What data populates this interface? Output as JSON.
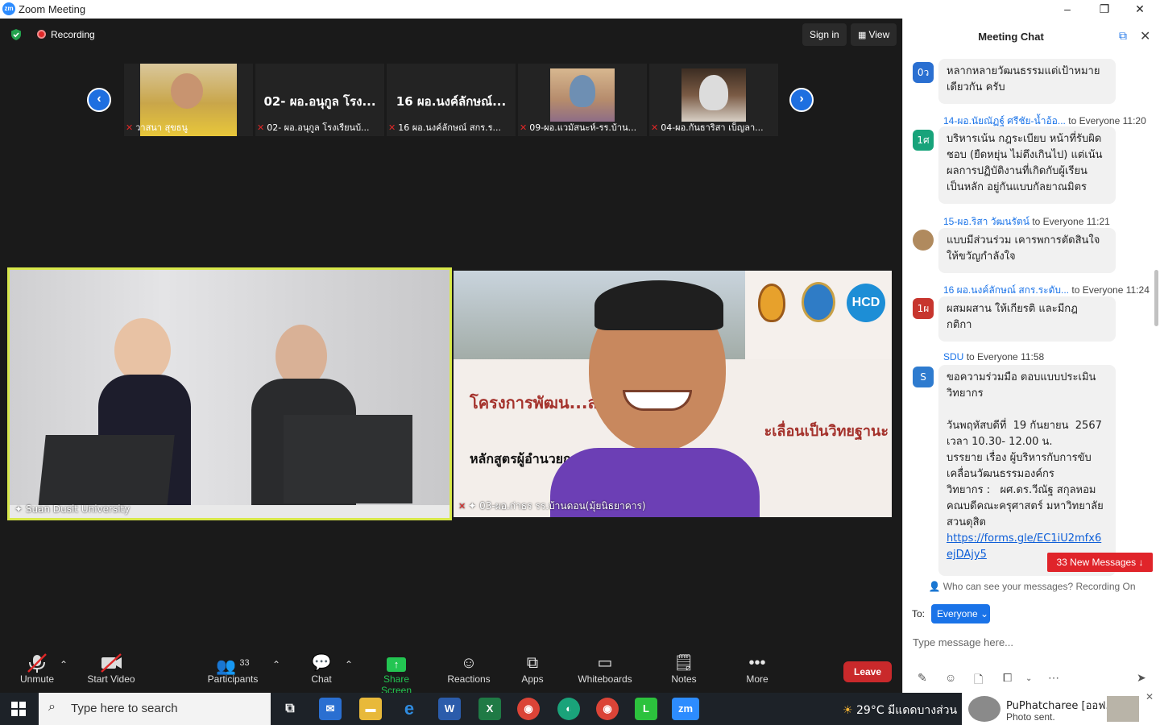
{
  "window": {
    "title": "Zoom Meeting",
    "minimize": "–",
    "restore": "❐",
    "close": "✕"
  },
  "topbar": {
    "recording": "Recording",
    "sign_in": "Sign in",
    "view": "View"
  },
  "thumbnails": [
    {
      "label": "วาสนา สุขธนู",
      "has_photo": true
    },
    {
      "display_name": "02- ผอ.อนุกูล โรง...",
      "label": "02- ผอ.อนุกูล โรงเรียนบ้..."
    },
    {
      "display_name": "16 ผอ.นงค์ลักษณ์...",
      "label": "16 ผอ.นงค์ลักษณ์ สกร.ร..."
    },
    {
      "label": "09-ผอ.แวมัสนะห์-รร.บ้าน...",
      "has_photo": true
    },
    {
      "label": "04-ผอ.กันธาริสา เบ็ญลา...",
      "has_photo": true
    }
  ],
  "videos": {
    "left_label": "Suan Dusit University",
    "right_label": "03-ผอ.ก่าธร รร.บ้านดอน(มุ้ยนิธยาคาร)",
    "banner_line1": "โครงการพัฒน...ลากรทางการศึกษา",
    "banner_line2": "ะเลื่อนเป็นวิทยฐานะ",
    "banner_line3": "หลักสูตรผู้อำนวยก...การเชี่ยวชาญ ระยะที่ 146",
    "logo_hcd": "HCD"
  },
  "toolbar": {
    "unmute": "Unmute",
    "start_video": "Start Video",
    "participants": "Participants",
    "participants_count": "33",
    "chat": "Chat",
    "share_screen": "Share Screen",
    "reactions": "Reactions",
    "apps": "Apps",
    "whiteboards": "Whiteboards",
    "notes": "Notes",
    "more": "More",
    "leave": "Leave"
  },
  "chat": {
    "title": "Meeting Chat",
    "messages": [
      {
        "avatar": "0ว",
        "avatar_color": "#2a6fd1",
        "sender": "",
        "to": "",
        "time": "",
        "text": "หลากหลายวัฒนธรรมแต่เป้าหมาย\nเดียวกัน ครับ"
      },
      {
        "avatar": "1ศ",
        "avatar_color": "#17a37a",
        "sender": "14-ผอ.นัยณัฏฐ์ ศรีชัย-น้ำอ้อ...",
        "to": "to Everyone",
        "time": "11:20",
        "text": "บริหารเน้น กฎระเบียบ หน้าที่รับผิด\nชอบ (ยืดหยุ่น ไม่ตึงเกินไป) แต่เน้น\nผลการปฏิบัติงานที่เกิดกับผู้เรียน\nเป็นหลัก อยู่กันแบบกัลยาณมิตร"
      },
      {
        "avatar": "",
        "avatar_color": "#b08a5e",
        "sender": "15-ผอ.ริสา วัฒนรัตน์",
        "to": "to Everyone",
        "time": "11:21",
        "text": "แบบมีส่วนร่วม เคารพการตัดสินใจ\nให้ขวัญกำลังใจ"
      },
      {
        "avatar": "1ผ",
        "avatar_color": "#c7352e",
        "sender": "16 ผอ.นงค์ลักษณ์ สกร.ระดับ...",
        "to": "to Everyone",
        "time": "11:24",
        "text": "ผสมผสาน ให้เกียรติ และมีกฎ\nกติกา"
      },
      {
        "avatar": "S",
        "avatar_color": "#2e7bcf",
        "sender": "SDU",
        "to": "to Everyone",
        "time": "11:58",
        "text": "ขอความร่วมมือ ตอบแบบประเมิน\nวิทยากร\n\nวันพฤหัสบดีที่  19 กันยายน  2567\nเวลา 10.30- 12.00 น.\nบรรยาย เรื่อง ผู้บริหารกับการขับ\nเคลื่อนวัฒนธรรมองค์กร\nวิทยากร :   ผศ.ดร.วีณัฐ สกุลหอม\nคณบดีคณะครุศาสตร์ มหาวิทยาลัย\nสวนดุสิต",
        "link": "https://forms.gle/EC1iU2mfx6ejDAjy5"
      }
    ],
    "new_messages": "33 New Messages",
    "who_can_see": "Who can see your messages? Recording On",
    "to_label": "To:",
    "to_value": "Everyone",
    "input_placeholder": "Type message here..."
  },
  "taskbar": {
    "search_placeholder": "Type here to search",
    "weather": "29°C  มีแดดบางส่วน",
    "notification_title": "PuPhatcharee [ออฟ...",
    "notification_body": "Photo sent."
  }
}
